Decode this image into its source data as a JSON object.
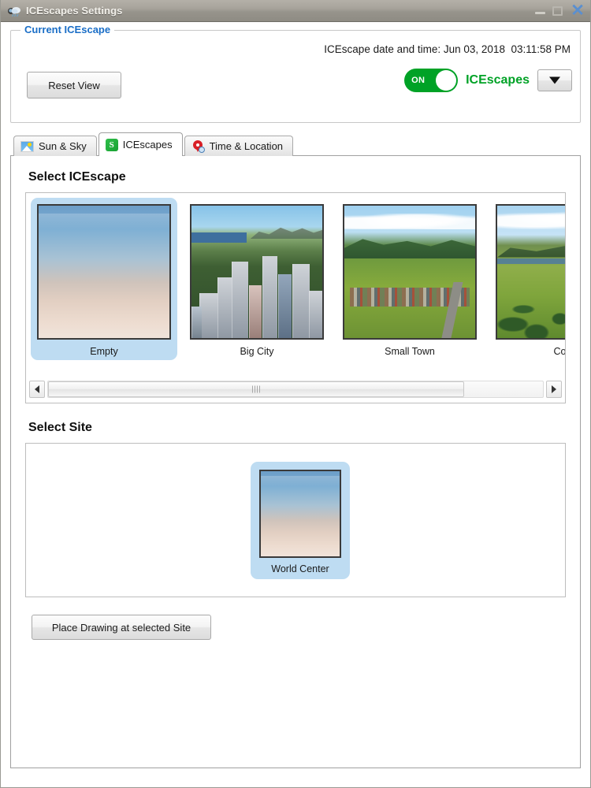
{
  "window": {
    "title": "ICEscapes Settings",
    "icon": "cloud-icon",
    "controls": {
      "minimize": "minimize-icon",
      "maximize": "maximize-icon",
      "close": "✕"
    }
  },
  "current_group": {
    "legend": "Current ICEscape",
    "datetime_label": "ICEscape date and time: Jun 03, 2018  03:11:58 PM",
    "reset_button": "Reset View",
    "toggle": {
      "state_label": "ON",
      "name_label": "ICEscapes",
      "enabled": true,
      "color": "#00a226"
    },
    "dropdown_button": "▼"
  },
  "tabs": [
    {
      "label": "Sun & Sky",
      "icon": "sky-icon",
      "active": false
    },
    {
      "label": "ICEscapes",
      "icon": "s-badge-icon",
      "active": true
    },
    {
      "label": "Time & Location",
      "icon": "map-pin-clock-icon",
      "active": false
    }
  ],
  "escape_section": {
    "title": "Select ICEscape",
    "items": [
      {
        "label": "Empty",
        "scene": "empty-sky",
        "selected": true
      },
      {
        "label": "Big City",
        "scene": "city",
        "selected": false
      },
      {
        "label": "Small Town",
        "scene": "town",
        "selected": false
      },
      {
        "label": "Cou",
        "scene": "countryside",
        "selected": false
      }
    ],
    "scrollbar": {
      "left_arrow": "◀",
      "right_arrow": "▶",
      "thumb_position_percent": 0,
      "thumb_width_percent": 84
    }
  },
  "site_section": {
    "title": "Select Site",
    "items": [
      {
        "label": "World Center",
        "scene": "empty-sky",
        "selected": true
      }
    ]
  },
  "place_button": {
    "label": "Place Drawing at selected Site"
  }
}
